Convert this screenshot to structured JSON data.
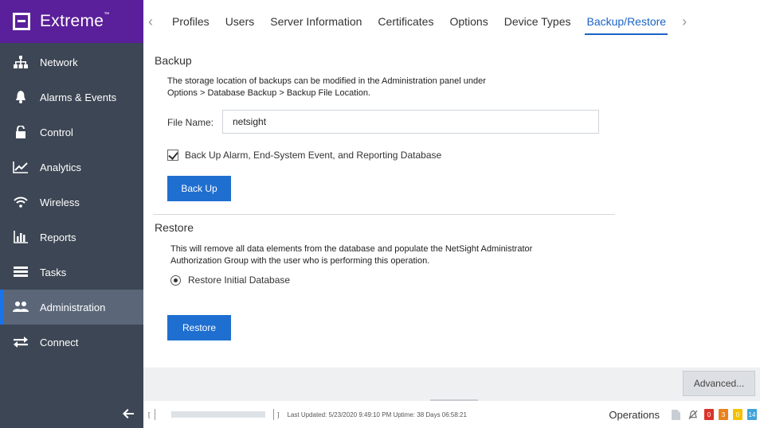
{
  "brand": {
    "name": "Extreme",
    "mark": "™"
  },
  "sidebar": {
    "items": [
      {
        "label": "Network",
        "icon": "network-icon"
      },
      {
        "label": "Alarms & Events",
        "icon": "bell-icon"
      },
      {
        "label": "Control",
        "icon": "lock-icon"
      },
      {
        "label": "Analytics",
        "icon": "line-chart-icon"
      },
      {
        "label": "Wireless",
        "icon": "wifi-icon"
      },
      {
        "label": "Reports",
        "icon": "bar-chart-icon"
      },
      {
        "label": "Tasks",
        "icon": "tasks-icon"
      },
      {
        "label": "Administration",
        "icon": "users-icon",
        "active": true
      },
      {
        "label": "Connect",
        "icon": "connect-arrows-icon"
      }
    ],
    "collapse_icon": "arrow-left-icon"
  },
  "tabs": {
    "items": [
      "Profiles",
      "Users",
      "Server Information",
      "Certificates",
      "Options",
      "Device Types",
      "Backup/Restore"
    ],
    "active": "Backup/Restore",
    "prev_icon": "‹",
    "next_icon": "›"
  },
  "backup": {
    "title": "Backup",
    "desc_line1": "The storage location of backups can be modified in the Administration panel under",
    "desc_line2": "Options > Database Backup > Backup File Location.",
    "file_label": "File Name:",
    "file_value": "netsight",
    "checkbox_label": "Back Up Alarm, End-System Event, and Reporting Database",
    "checkbox_checked": true,
    "button_label": "Back Up"
  },
  "restore": {
    "title": "Restore",
    "desc_line1": "This will remove all data elements from the database and populate the NetSight Administrator",
    "desc_line2": "Authorization Group with the user who is performing this operation.",
    "radio_label": "Restore Initial Database",
    "button_label": "Restore"
  },
  "advanced_button": "Advanced...",
  "statusbar": {
    "bracket_open": "[",
    "bracket_close": "]",
    "updated": "Last Updated: 5/23/2020 9:49:10 PM   Uptime: 38 Days 06:58:21",
    "operations": "Operations",
    "badges": [
      {
        "value": "0",
        "color": "#d9342b"
      },
      {
        "value": "3",
        "color": "#e8821e"
      },
      {
        "value": "0",
        "color": "#f2c200"
      },
      {
        "value": "14",
        "color": "#3fa3d8"
      }
    ]
  },
  "colors": {
    "brand": "#5a1f9a",
    "sidebar": "#3d4654",
    "accent": "#1f6fd1"
  }
}
